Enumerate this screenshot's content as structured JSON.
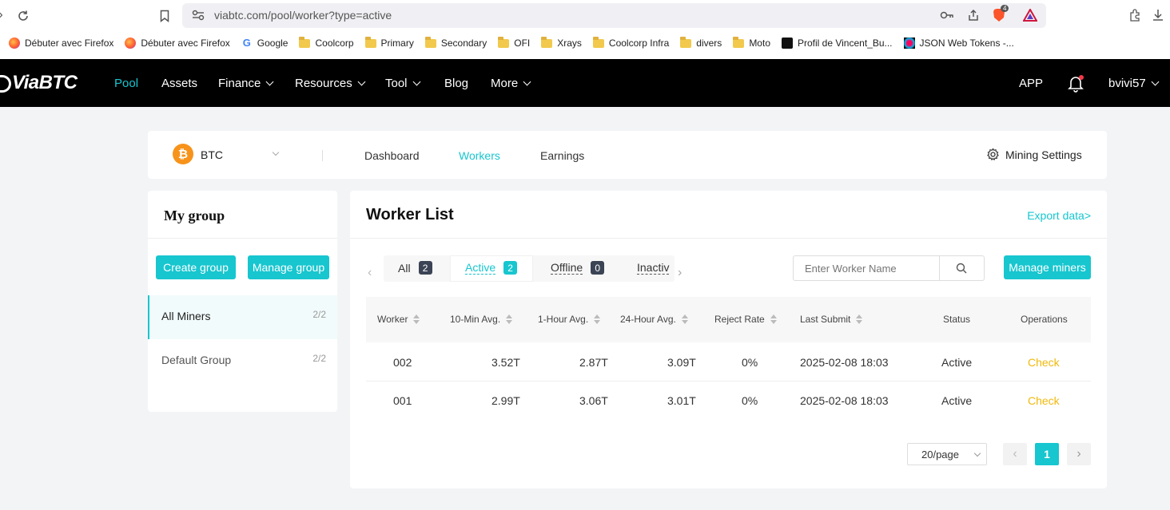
{
  "browser": {
    "url": "viabtc.com/pool/worker?type=active",
    "extension_badge": "4",
    "bookmarks": [
      {
        "label": "Débuter avec Firefox",
        "icon": "firefox-icon"
      },
      {
        "label": "Débuter avec Firefox",
        "icon": "firefox-icon"
      },
      {
        "label": "Google",
        "icon": "google-icon"
      },
      {
        "label": "Coolcorp",
        "icon": "folder-icon"
      },
      {
        "label": "Primary",
        "icon": "folder-icon"
      },
      {
        "label": "Secondary",
        "icon": "folder-icon"
      },
      {
        "label": "OFI",
        "icon": "folder-icon"
      },
      {
        "label": "Xrays",
        "icon": "folder-icon"
      },
      {
        "label": "Coolcorp Infra",
        "icon": "folder-icon"
      },
      {
        "label": "divers",
        "icon": "folder-icon"
      },
      {
        "label": "Moto",
        "icon": "folder-icon"
      },
      {
        "label": "Profil de Vincent_Bu...",
        "icon": "profile-icon"
      },
      {
        "label": "JSON Web Tokens -...",
        "icon": "jwt-icon"
      }
    ]
  },
  "nav": {
    "logo": "ViaBTC",
    "items": [
      "Pool",
      "Assets",
      "Finance",
      "Resources",
      "Tool",
      "Blog",
      "More"
    ],
    "app": "APP",
    "user": "bvivi57"
  },
  "subnav": {
    "coin": "BTC",
    "coin_symbol": "₿",
    "tabs": [
      "Dashboard",
      "Workers",
      "Earnings"
    ],
    "mining_settings": "Mining Settings"
  },
  "group": {
    "title": "My group",
    "create": "Create group",
    "manage": "Manage group",
    "items": [
      {
        "label": "All Miners",
        "count": "2/2"
      },
      {
        "label": "Default Group",
        "count": "2/2"
      }
    ]
  },
  "workers": {
    "title": "Worker List",
    "export": "Export data>",
    "tabs": [
      {
        "label": "All",
        "count": "2"
      },
      {
        "label": "Active",
        "count": "2"
      },
      {
        "label": "Offline",
        "count": "0"
      },
      {
        "label": "Inactiv",
        "count": ""
      }
    ],
    "search_placeholder": "Enter Worker Name",
    "manage_miners": "Manage miners",
    "columns": [
      "Worker",
      "10-Min Avg.",
      "1-Hour Avg.",
      "24-Hour Avg.",
      "Reject Rate",
      "Last Submit",
      "Status",
      "Operations"
    ],
    "rows": [
      {
        "worker": "002",
        "min10": "3.52T",
        "hour1": "2.87T",
        "hour24": "3.09T",
        "reject": "0%",
        "last": "2025-02-08 18:03",
        "status": "Active",
        "op": "Check"
      },
      {
        "worker": "001",
        "min10": "2.99T",
        "hour1": "3.06T",
        "hour24": "3.01T",
        "reject": "0%",
        "last": "2025-02-08 18:03",
        "status": "Active",
        "op": "Check"
      }
    ],
    "page_size": "20/page",
    "page": "1"
  },
  "colors": {
    "accent": "#17c6cf",
    "check": "#f0b90b",
    "nav_bg": "#000000"
  }
}
